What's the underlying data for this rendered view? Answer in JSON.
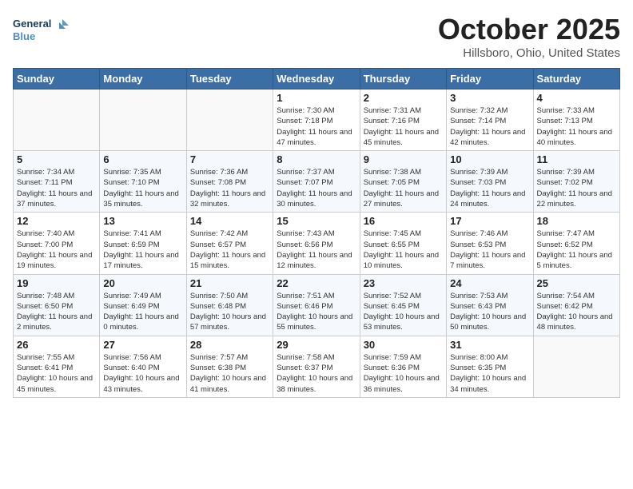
{
  "header": {
    "logo_line1": "General",
    "logo_line2": "Blue",
    "month": "October 2025",
    "location": "Hillsboro, Ohio, United States"
  },
  "weekdays": [
    "Sunday",
    "Monday",
    "Tuesday",
    "Wednesday",
    "Thursday",
    "Friday",
    "Saturday"
  ],
  "weeks": [
    [
      {
        "num": "",
        "detail": ""
      },
      {
        "num": "",
        "detail": ""
      },
      {
        "num": "",
        "detail": ""
      },
      {
        "num": "1",
        "detail": "Sunrise: 7:30 AM\nSunset: 7:18 PM\nDaylight: 11 hours\nand 47 minutes."
      },
      {
        "num": "2",
        "detail": "Sunrise: 7:31 AM\nSunset: 7:16 PM\nDaylight: 11 hours\nand 45 minutes."
      },
      {
        "num": "3",
        "detail": "Sunrise: 7:32 AM\nSunset: 7:14 PM\nDaylight: 11 hours\nand 42 minutes."
      },
      {
        "num": "4",
        "detail": "Sunrise: 7:33 AM\nSunset: 7:13 PM\nDaylight: 11 hours\nand 40 minutes."
      }
    ],
    [
      {
        "num": "5",
        "detail": "Sunrise: 7:34 AM\nSunset: 7:11 PM\nDaylight: 11 hours\nand 37 minutes."
      },
      {
        "num": "6",
        "detail": "Sunrise: 7:35 AM\nSunset: 7:10 PM\nDaylight: 11 hours\nand 35 minutes."
      },
      {
        "num": "7",
        "detail": "Sunrise: 7:36 AM\nSunset: 7:08 PM\nDaylight: 11 hours\nand 32 minutes."
      },
      {
        "num": "8",
        "detail": "Sunrise: 7:37 AM\nSunset: 7:07 PM\nDaylight: 11 hours\nand 30 minutes."
      },
      {
        "num": "9",
        "detail": "Sunrise: 7:38 AM\nSunset: 7:05 PM\nDaylight: 11 hours\nand 27 minutes."
      },
      {
        "num": "10",
        "detail": "Sunrise: 7:39 AM\nSunset: 7:03 PM\nDaylight: 11 hours\nand 24 minutes."
      },
      {
        "num": "11",
        "detail": "Sunrise: 7:39 AM\nSunset: 7:02 PM\nDaylight: 11 hours\nand 22 minutes."
      }
    ],
    [
      {
        "num": "12",
        "detail": "Sunrise: 7:40 AM\nSunset: 7:00 PM\nDaylight: 11 hours\nand 19 minutes."
      },
      {
        "num": "13",
        "detail": "Sunrise: 7:41 AM\nSunset: 6:59 PM\nDaylight: 11 hours\nand 17 minutes."
      },
      {
        "num": "14",
        "detail": "Sunrise: 7:42 AM\nSunset: 6:57 PM\nDaylight: 11 hours\nand 15 minutes."
      },
      {
        "num": "15",
        "detail": "Sunrise: 7:43 AM\nSunset: 6:56 PM\nDaylight: 11 hours\nand 12 minutes."
      },
      {
        "num": "16",
        "detail": "Sunrise: 7:45 AM\nSunset: 6:55 PM\nDaylight: 11 hours\nand 10 minutes."
      },
      {
        "num": "17",
        "detail": "Sunrise: 7:46 AM\nSunset: 6:53 PM\nDaylight: 11 hours\nand 7 minutes."
      },
      {
        "num": "18",
        "detail": "Sunrise: 7:47 AM\nSunset: 6:52 PM\nDaylight: 11 hours\nand 5 minutes."
      }
    ],
    [
      {
        "num": "19",
        "detail": "Sunrise: 7:48 AM\nSunset: 6:50 PM\nDaylight: 11 hours\nand 2 minutes."
      },
      {
        "num": "20",
        "detail": "Sunrise: 7:49 AM\nSunset: 6:49 PM\nDaylight: 11 hours\nand 0 minutes."
      },
      {
        "num": "21",
        "detail": "Sunrise: 7:50 AM\nSunset: 6:48 PM\nDaylight: 10 hours\nand 57 minutes."
      },
      {
        "num": "22",
        "detail": "Sunrise: 7:51 AM\nSunset: 6:46 PM\nDaylight: 10 hours\nand 55 minutes."
      },
      {
        "num": "23",
        "detail": "Sunrise: 7:52 AM\nSunset: 6:45 PM\nDaylight: 10 hours\nand 53 minutes."
      },
      {
        "num": "24",
        "detail": "Sunrise: 7:53 AM\nSunset: 6:43 PM\nDaylight: 10 hours\nand 50 minutes."
      },
      {
        "num": "25",
        "detail": "Sunrise: 7:54 AM\nSunset: 6:42 PM\nDaylight: 10 hours\nand 48 minutes."
      }
    ],
    [
      {
        "num": "26",
        "detail": "Sunrise: 7:55 AM\nSunset: 6:41 PM\nDaylight: 10 hours\nand 45 minutes."
      },
      {
        "num": "27",
        "detail": "Sunrise: 7:56 AM\nSunset: 6:40 PM\nDaylight: 10 hours\nand 43 minutes."
      },
      {
        "num": "28",
        "detail": "Sunrise: 7:57 AM\nSunset: 6:38 PM\nDaylight: 10 hours\nand 41 minutes."
      },
      {
        "num": "29",
        "detail": "Sunrise: 7:58 AM\nSunset: 6:37 PM\nDaylight: 10 hours\nand 38 minutes."
      },
      {
        "num": "30",
        "detail": "Sunrise: 7:59 AM\nSunset: 6:36 PM\nDaylight: 10 hours\nand 36 minutes."
      },
      {
        "num": "31",
        "detail": "Sunrise: 8:00 AM\nSunset: 6:35 PM\nDaylight: 10 hours\nand 34 minutes."
      },
      {
        "num": "",
        "detail": ""
      }
    ]
  ]
}
